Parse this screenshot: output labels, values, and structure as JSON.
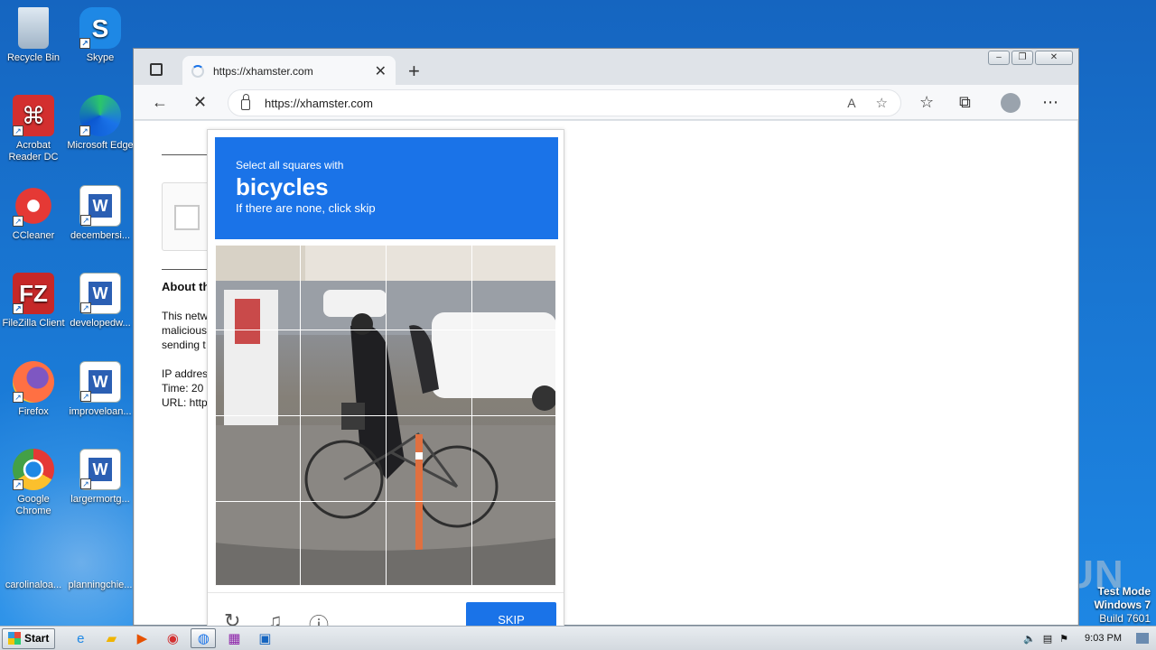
{
  "desktop": {
    "icons_left": [
      {
        "label": "Recycle Bin",
        "icon": "recycle-bin-icon"
      },
      {
        "label": "Acrobat Reader DC",
        "icon": "acrobat-icon"
      },
      {
        "label": "CCleaner",
        "icon": "ccleaner-icon"
      },
      {
        "label": "FileZilla Client",
        "icon": "filezilla-icon"
      },
      {
        "label": "Firefox",
        "icon": "firefox-icon"
      },
      {
        "label": "Google Chrome",
        "icon": "chrome-icon"
      },
      {
        "label": "carolinaloa...",
        "icon": "file-icon"
      }
    ],
    "icons_right": [
      {
        "label": "Skype",
        "icon": "skype-icon"
      },
      {
        "label": "Microsoft Edge",
        "icon": "edge-icon"
      },
      {
        "label": "decembersi...",
        "icon": "word-doc-icon"
      },
      {
        "label": "developedw...",
        "icon": "word-doc-icon"
      },
      {
        "label": "improveloan...",
        "icon": "word-doc-icon"
      },
      {
        "label": "largermortg...",
        "icon": "word-doc-icon"
      },
      {
        "label": "planningchie...",
        "icon": "file-icon"
      }
    ]
  },
  "browser": {
    "tab_title": "https://xhamster.com",
    "address": "https://xhamster.com",
    "window_buttons": [
      "–",
      "❐",
      "✕"
    ]
  },
  "page": {
    "about_heading": "About th",
    "text_lines": [
      "This netw",
      "malicious",
      "sending t"
    ],
    "ip_line": "IP addres",
    "time_line": "Time: 20",
    "url_line": "URL: http"
  },
  "captcha": {
    "instruction": "Select all squares with",
    "target": "bicycles",
    "hint": "If there are none, click skip",
    "skip_label": "SKIP"
  },
  "watermark": "ANY RUN",
  "test_mode": {
    "line1": "Test Mode",
    "line2": "Windows 7",
    "line3": "Build 7601"
  },
  "taskbar": {
    "start_label": "Start",
    "clock": "9:03 PM"
  }
}
